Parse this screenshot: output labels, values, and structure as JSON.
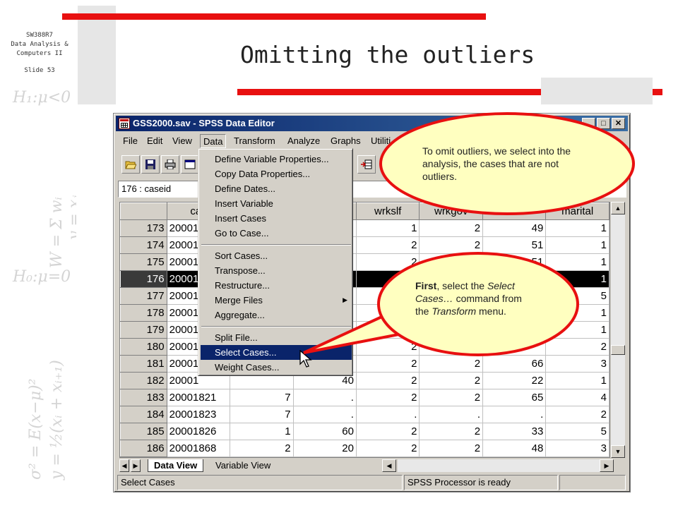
{
  "slide": {
    "course_code": "SW388R7",
    "course_line2": "Data Analysis &",
    "course_line3": "Computers II",
    "slide_number": "Slide 53",
    "title": "Omitting the outliers"
  },
  "window": {
    "title": "GSS2000.sav - SPSS Data Editor",
    "controls": {
      "minimize": "_",
      "maximize": "□",
      "close": "✕"
    }
  },
  "menubar": {
    "items": [
      "File",
      "Edit",
      "View",
      "Data",
      "Transform",
      "Analyze",
      "Graphs",
      "Utiliti"
    ],
    "active": "Data"
  },
  "toolbar": {
    "icons": [
      "open-folder-icon",
      "save-icon",
      "print-icon",
      "dialog-recall-icon",
      "goto-variable-icon"
    ]
  },
  "cell_reference": "176 : caseid",
  "grid": {
    "columns": [
      "",
      "cas",
      "",
      "",
      "wrkslf",
      "wrkgov",
      "",
      "marital"
    ],
    "rows": [
      {
        "num": "173",
        "caseid": "20001",
        "c2": "",
        "c3": "",
        "wrkslf": "1",
        "wrkgov": "2",
        "c6": "49",
        "marital": "1"
      },
      {
        "num": "174",
        "caseid": "20001",
        "c2": "",
        "c3": "",
        "wrkslf": "2",
        "wrkgov": "2",
        "c6": "51",
        "marital": "1"
      },
      {
        "num": "175",
        "caseid": "20001",
        "c2": "",
        "c3": "",
        "wrkslf": "2",
        "wrkgov": "",
        "c6": "51",
        "marital": "1"
      },
      {
        "num": "176",
        "caseid": "20001",
        "c2": "",
        "c3": "",
        "wrkslf": "",
        "wrkgov": "",
        "c6": "",
        "marital": "1"
      },
      {
        "num": "177",
        "caseid": "20001",
        "c2": "",
        "c3": "",
        "wrkslf": "",
        "wrkgov": "",
        "c6": "",
        "marital": "5"
      },
      {
        "num": "178",
        "caseid": "20001",
        "c2": "",
        "c3": "",
        "wrkslf": "",
        "wrkgov": "",
        "c6": "",
        "marital": "1"
      },
      {
        "num": "179",
        "caseid": "20001",
        "c2": "",
        "c3": "",
        "wrkslf": "",
        "wrkgov": "",
        "c6": "",
        "marital": "1"
      },
      {
        "num": "180",
        "caseid": "20001",
        "c2": "",
        "c3": "",
        "wrkslf": "2",
        "wrkgov": "",
        "c6": "",
        "marital": "2"
      },
      {
        "num": "181",
        "caseid": "20001",
        "c2": "",
        "c3": "",
        "wrkslf": "2",
        "wrkgov": "2",
        "c6": "66",
        "marital": "3"
      },
      {
        "num": "182",
        "caseid": "20001",
        "c2": "",
        "c3": "40",
        "wrkslf": "2",
        "wrkgov": "2",
        "c6": "22",
        "marital": "1"
      },
      {
        "num": "183",
        "caseid": "20001821",
        "c2": "7",
        "c3": ".",
        "wrkslf": "2",
        "wrkgov": "2",
        "c6": "65",
        "marital": "4"
      },
      {
        "num": "184",
        "caseid": "20001823",
        "c2": "7",
        "c3": ".",
        "wrkslf": ".",
        "wrkgov": ".",
        "c6": ".",
        "marital": "2"
      },
      {
        "num": "185",
        "caseid": "20001826",
        "c2": "1",
        "c3": "60",
        "wrkslf": "2",
        "wrkgov": "2",
        "c6": "33",
        "marital": "5"
      },
      {
        "num": "186",
        "caseid": "20001868",
        "c2": "2",
        "c3": "20",
        "wrkslf": "2",
        "wrkgov": "2",
        "c6": "48",
        "marital": "3"
      }
    ],
    "selected_row": "176"
  },
  "tabs": {
    "data_view": "Data View",
    "variable_view": "Variable View"
  },
  "status": {
    "left": "Select Cases",
    "right": "SPSS Processor  is ready"
  },
  "dropdown": {
    "group1": [
      "Define Variable Properties...",
      "Copy Data Properties...",
      "Define Dates...",
      "Insert Variable",
      "Insert Cases",
      "Go to Case..."
    ],
    "group2": [
      "Sort Cases...",
      "Transpose...",
      "Restructure...",
      "Merge Files",
      "Aggregate..."
    ],
    "group3": [
      "Split File...",
      "Select Cases...",
      "Weight Cases..."
    ],
    "submenu_item": "Merge Files",
    "highlighted": "Select Cases..."
  },
  "callouts": {
    "top": "To omit outliers, we select into the analysis,  the cases that are not outliers.",
    "bottom_bold": "First",
    "bottom_part1": ", select the ",
    "bottom_italic1": "Select Cases…",
    "bottom_part2": " command from the ",
    "bottom_italic2": "Transform",
    "bottom_part3": " menu.",
    "fill": "#ffffc0",
    "border": "#e81010"
  }
}
